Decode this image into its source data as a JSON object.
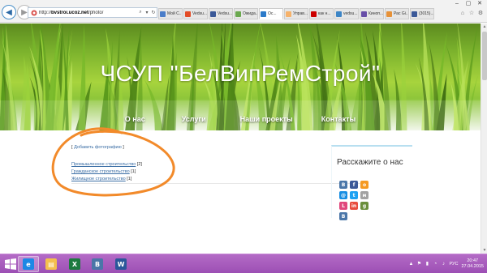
{
  "browser": {
    "url_prefix": "http://",
    "url_host": "bvstroi.ucoz.net",
    "url_path": "/photo/",
    "tabs": [
      {
        "label": "Мой С...",
        "icon_color": "#4a7dc9",
        "active": false
      },
      {
        "label": "Vedsu...",
        "icon_color": "#e34c26",
        "active": false
      },
      {
        "label": "Vedsu...",
        "icon_color": "#3b5998",
        "active": false
      },
      {
        "label": "Ожида...",
        "icon_color": "#6aa84f",
        "active": false
      },
      {
        "label": "Ос...",
        "icon_color": "#2c7ac9",
        "active": true
      },
      {
        "label": "Управ...",
        "icon_color": "#f6b26b",
        "active": false
      },
      {
        "label": "как н...",
        "icon_color": "#cc0000",
        "active": false
      },
      {
        "label": "vedsu...",
        "icon_color": "#3d85c6",
        "active": false
      },
      {
        "label": "Киноп...",
        "icon_color": "#674ea7",
        "active": false
      },
      {
        "label": "Рас Gi...",
        "icon_color": "#e69138",
        "active": false
      },
      {
        "label": "(3015)...",
        "icon_color": "#3b5998",
        "active": false
      }
    ]
  },
  "site": {
    "title": "ЧСУП \"БелВипРемСтрой\"",
    "menu": [
      "О нас",
      "Услуги",
      "Наши проекты",
      "Контакты"
    ]
  },
  "content": {
    "add_photo_open": "[ ",
    "add_photo_link": "Добавить фотографию",
    "add_photo_close": " ]",
    "categories": [
      {
        "name": "Промышленное строительство",
        "count": "[2]"
      },
      {
        "name": "Гражданское строительство",
        "count": "[1]"
      },
      {
        "name": "Жилищное строительство",
        "count": "[1]"
      }
    ]
  },
  "sidebar": {
    "share_title": "Расскажите о нас",
    "share_icons": [
      {
        "name": "vk-share-icon",
        "glyph": "В",
        "color": "#4a76a8"
      },
      {
        "name": "facebook-share-icon",
        "glyph": "f",
        "color": "#3b5998"
      },
      {
        "name": "odnoklassniki-share-icon",
        "glyph": "о",
        "color": "#f59a23"
      },
      {
        "name": "mailru-share-icon",
        "glyph": "@",
        "color": "#168de2"
      },
      {
        "name": "twitter-share-icon",
        "glyph": "t",
        "color": "#1da1f2"
      },
      {
        "name": "moimir-share-icon",
        "glyph": "м",
        "color": "#a2a2a2"
      },
      {
        "name": "liveinternet-share-icon",
        "glyph": "L",
        "color": "#e0467c"
      },
      {
        "name": "linkedin-share-icon",
        "glyph": "in",
        "color": "#e84c3d"
      },
      {
        "name": "google-share-icon",
        "glyph": "g",
        "color": "#6a8f3c"
      },
      {
        "name": "vkontakte-share-icon",
        "glyph": "В",
        "color": "#4a76a8"
      }
    ]
  },
  "taskbar": {
    "apps": [
      {
        "name": "ie-taskbar-icon",
        "glyph": "e",
        "color": "#1e88e5",
        "active": true
      },
      {
        "name": "explorer-taskbar-icon",
        "glyph": "▤",
        "color": "#f4c04e",
        "active": false
      },
      {
        "name": "excel-taskbar-icon",
        "glyph": "X",
        "color": "#1d7a3f",
        "active": false
      },
      {
        "name": "vk-taskbar-icon",
        "glyph": "В",
        "color": "#4a76a8",
        "active": false
      },
      {
        "name": "word-taskbar-icon",
        "glyph": "W",
        "color": "#2b579a",
        "active": false
      }
    ],
    "lang": "РУС",
    "time": "20:47",
    "date": "27.04.2015"
  }
}
